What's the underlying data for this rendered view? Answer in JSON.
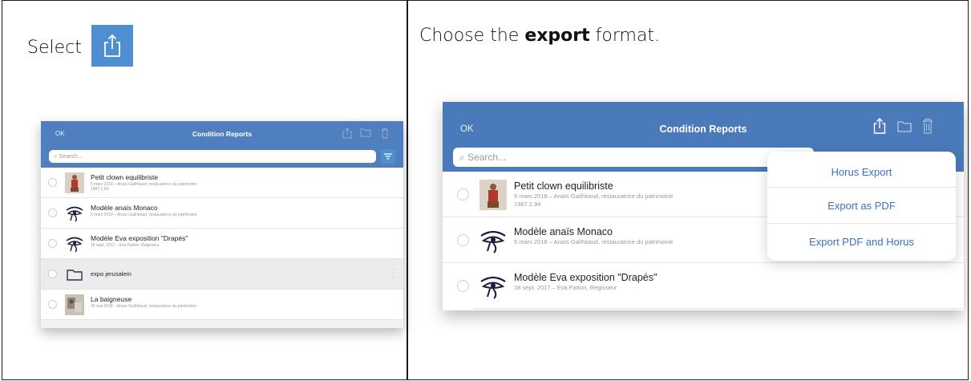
{
  "left_cell": {
    "instruction_text": "Select",
    "share_icon": "share-export-icon"
  },
  "right_cell": {
    "instruction_prefix": "Choose the ",
    "instruction_bold": "export",
    "instruction_suffix": " format."
  },
  "app": {
    "nav": {
      "ok_label": "OK",
      "title": "Condition Reports"
    },
    "search_placeholder": "Search...",
    "rows": [
      {
        "title": "Petit clown equilibriste",
        "subtitle": "5 mars 2018 – Anaïs Gailhbaud, restauratrice du patrimoine",
        "detail": "1967.1.94",
        "thumb": "clown-figure-thumb"
      },
      {
        "title": "Modèle anaïs Monaco",
        "subtitle": "5 mars 2018 – Anaïs Gailhbaud, restauratrice du patrimoine",
        "detail": "",
        "thumb": "eye-of-horus-thumb"
      },
      {
        "title": "Modèle Eva exposition \"Drapés\"",
        "subtitle": "18 sept. 2017 – Eva Patton, Regisseur",
        "detail": "",
        "thumb": "eye-of-horus-thumb"
      },
      {
        "title": "expo jerusalem",
        "subtitle": "",
        "detail": "",
        "thumb": "folder-icon"
      },
      {
        "title": "La baigneuse",
        "subtitle": "30 mai 2018 – Anaïs Gailhbaud, restauratrice du patrimoine",
        "detail": "",
        "thumb": "painting-thumb"
      }
    ],
    "export_menu": [
      "Horus Export",
      "Export as PDF",
      "Export PDF and Horus"
    ]
  },
  "colors": {
    "nav_blue": "#4a7ab9",
    "share_tile": "#4f8fd1",
    "menu_text": "#3a72c0"
  }
}
